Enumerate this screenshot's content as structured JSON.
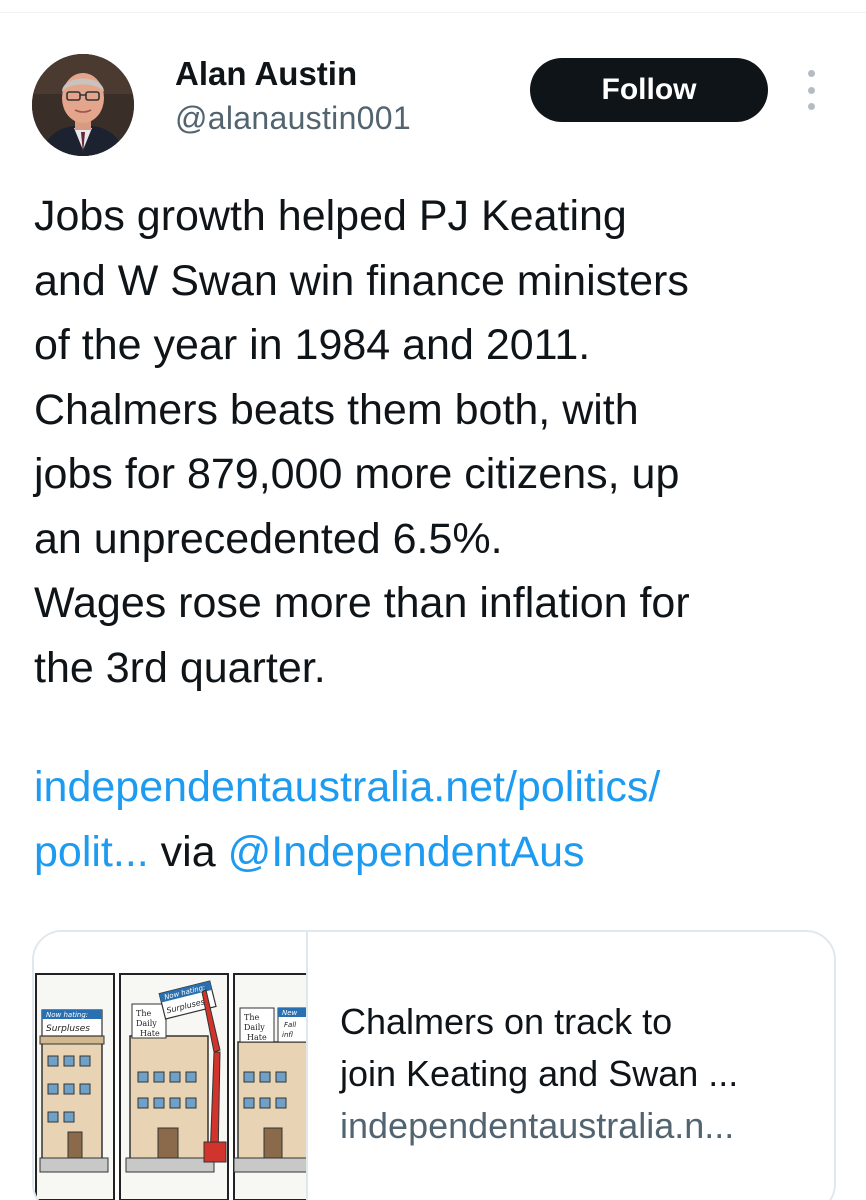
{
  "author": {
    "display_name": "Alan Austin",
    "handle": "@alanaustin001",
    "avatar_icon": "profile-photo"
  },
  "actions": {
    "follow_label": "Follow",
    "more_icon": "more-vertical-icon"
  },
  "tweet": {
    "lines": [
      "Jobs growth helped PJ Keating",
      "and W Swan win finance ministers",
      "of the year in 1984 and 2011.",
      "Chalmers beats them both, with",
      "jobs for 879,000 more citizens, up",
      "an unprecedented 6.5%.",
      "Wages rose more than inflation for",
      "the 3rd quarter."
    ],
    "link_line1": "independentaustralia.net/politics/",
    "link_line2": "polit...",
    "via_text": " via ",
    "mention": "@IndependentAus"
  },
  "card": {
    "image_alt": "Cartoon of three panels: buildings labelled The Daily Hate with signs 'Now hating: Surpluses'",
    "image_signs": {
      "panel1_sign_top": "Now hating:",
      "panel1_sign_bottom": "Surpluses",
      "panel2_sign_top": "Now hating:",
      "panel2_sign_bottom": "Surpluses",
      "panel2_building_line1": "The",
      "panel2_building_line2": "Daily",
      "panel2_building_line3": "Hate",
      "panel3_building_line1": "The",
      "panel3_building_line2": "Daily",
      "panel3_building_line3": "Hate",
      "panel3_sign_top": "New",
      "panel3_sign_mid": "Fall",
      "panel3_sign_bottom": "infl"
    },
    "title_line1": "Chalmers on track to",
    "title_line2": "join Keating and Swan ...",
    "domain": "independentaustralia.n..."
  },
  "colors": {
    "link": "#1d9bf0",
    "text": "#0f1419",
    "secondary": "#536471",
    "button_bg": "#0f1419",
    "button_text": "#ffffff"
  }
}
